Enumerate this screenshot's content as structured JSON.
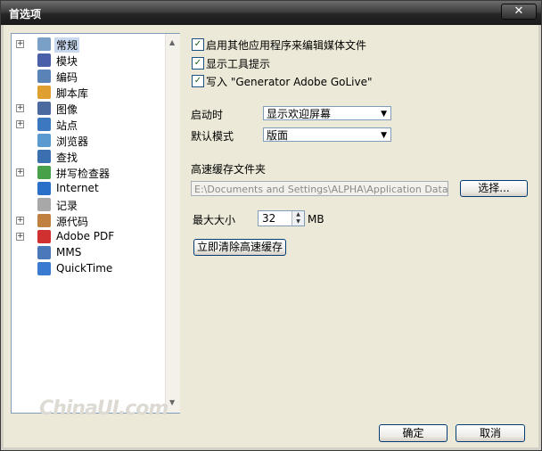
{
  "window": {
    "title": "首选项",
    "close_label": "✕"
  },
  "tree": {
    "items": [
      {
        "label": "常规",
        "expander": "+",
        "icon": "general-icon",
        "color": "#7aa0c8",
        "selected": true
      },
      {
        "label": "模块",
        "expander": "",
        "icon": "module-icon",
        "color": "#4b5fa8"
      },
      {
        "label": "编码",
        "expander": "",
        "icon": "code-icon",
        "color": "#5a84b8"
      },
      {
        "label": "脚本库",
        "expander": "",
        "icon": "script-library-icon",
        "color": "#e0a030"
      },
      {
        "label": "图像",
        "expander": "+",
        "icon": "image-icon",
        "color": "#4a6aa0"
      },
      {
        "label": "站点",
        "expander": "+",
        "icon": "site-icon",
        "color": "#3c78c0"
      },
      {
        "label": "浏览器",
        "expander": "",
        "icon": "browser-icon",
        "color": "#5a9ad0"
      },
      {
        "label": "查找",
        "expander": "",
        "icon": "find-icon",
        "color": "#3a70b0"
      },
      {
        "label": "拼写检查器",
        "expander": "+",
        "icon": "spellcheck-icon",
        "color": "#48a048"
      },
      {
        "label": "Internet",
        "expander": "",
        "icon": "internet-icon",
        "color": "#2a70c8"
      },
      {
        "label": "记录",
        "expander": "",
        "icon": "log-icon",
        "color": "#a8a8a8"
      },
      {
        "label": "源代码",
        "expander": "+",
        "icon": "source-code-icon",
        "color": "#c08040"
      },
      {
        "label": "Adobe PDF",
        "expander": "+",
        "icon": "adobe-pdf-icon",
        "color": "#d03030"
      },
      {
        "label": "MMS",
        "expander": "",
        "icon": "mms-icon",
        "color": "#4a78b8"
      },
      {
        "label": "QuickTime",
        "expander": "",
        "icon": "quicktime-icon",
        "color": "#3a7ad0"
      }
    ]
  },
  "options": {
    "checks": [
      {
        "label": "启用其他应用程序来编辑媒体文件",
        "checked": true
      },
      {
        "label": "显示工具提示",
        "checked": true
      },
      {
        "label": "写入 \"Generator Adobe GoLive\"",
        "checked": true
      }
    ],
    "check_mark": "✓",
    "startup_label": "启动时",
    "startup_value": "显示欢迎屏幕",
    "default_mode_label": "默认模式",
    "default_mode_value": "版面",
    "dropdown_arrow": "▼",
    "cache_folder_label": "高速缓存文件夹",
    "cache_path": "E:\\Documents and Settings\\ALPHA\\Application Data\\Adobe\\",
    "choose_button": "选择...",
    "max_size_label": "最大大小",
    "max_size_value": "32",
    "max_size_unit": "MB",
    "spin_up": "▲",
    "spin_down": "▼",
    "clear_cache_button": "立即清除高速缓存"
  },
  "footer": {
    "ok_button": "确定",
    "cancel_button": "取消"
  },
  "watermark": "ChinaUI.com",
  "scroll": {
    "up": "▲",
    "down": "▼"
  }
}
